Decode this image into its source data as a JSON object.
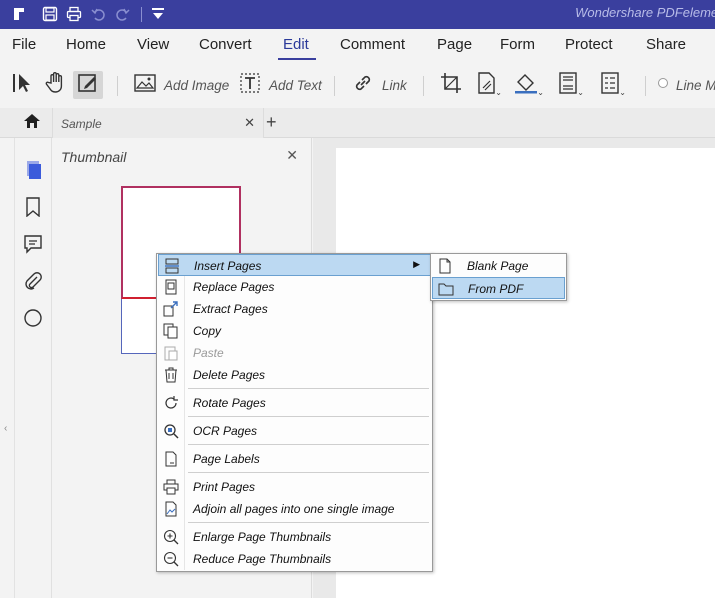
{
  "app": {
    "title": "Wondershare PDFelement"
  },
  "menu": [
    "File",
    "Home",
    "View",
    "Convert",
    "Edit",
    "Comment",
    "Page",
    "Form",
    "Protect",
    "Share"
  ],
  "toolbar": {
    "add_image": "Add Image",
    "add_text": "Add Text",
    "link": "Link",
    "line_mode": "Line Mo"
  },
  "tab": {
    "name": "Sample"
  },
  "thumbnail": {
    "title": "Thumbnail"
  },
  "context_menu": {
    "items": [
      {
        "label": "Insert Pages",
        "icon": "insert-pages-icon",
        "has_submenu": true,
        "highlighted": true
      },
      {
        "label": "Replace Pages",
        "icon": "replace-pages-icon"
      },
      {
        "label": "Extract Pages",
        "icon": "extract-pages-icon"
      },
      {
        "label": "Copy",
        "icon": "copy-icon"
      },
      {
        "label": "Paste",
        "icon": "paste-icon",
        "disabled": true
      },
      {
        "label": "Delete Pages",
        "icon": "trash-icon"
      },
      {
        "label": "Rotate Pages",
        "icon": "rotate-icon"
      },
      {
        "label": "OCR Pages",
        "icon": "ocr-icon"
      },
      {
        "label": "Page Labels",
        "icon": "page-labels-icon"
      },
      {
        "label": "Print Pages",
        "icon": "print-icon"
      },
      {
        "label": "Adjoin all pages into one single image",
        "icon": "image-icon"
      },
      {
        "label": "Enlarge Page Thumbnails",
        "icon": "zoom-in-icon"
      },
      {
        "label": "Reduce Page Thumbnails",
        "icon": "zoom-out-icon"
      }
    ]
  },
  "submenu": {
    "items": [
      {
        "label": "Blank Page",
        "icon": "blank-page-icon"
      },
      {
        "label": "From PDF",
        "icon": "folder-icon",
        "highlighted": true
      }
    ]
  },
  "colors": {
    "title_bar": "#3a3f9e",
    "accent": "#3a3f9e",
    "highlight": "#bcd9f2"
  }
}
